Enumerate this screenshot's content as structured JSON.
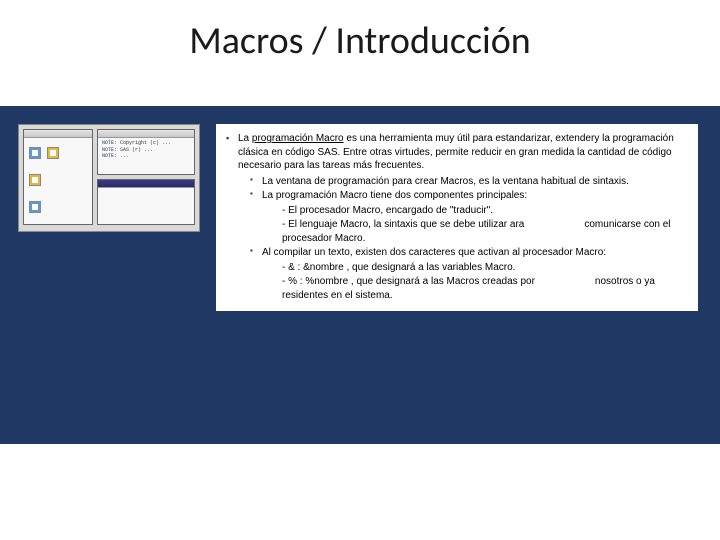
{
  "title": "Macros / Introducción",
  "main": {
    "lead_pre": "La ",
    "lead_term": "programación Macro",
    "lead_post": " es una herramienta muy útil para estandarizar,  extendery la programación clásica en código SAS. Entre otras virtudes, permite reducir en gran medida la cantidad de código necesario para las tareas más frecuentes.",
    "sub1": "La ventana de programación para crear Macros, es la ventana habitual       de sintaxis.",
    "sub2": "La programación Macro tiene dos componentes principales:",
    "sub2a": "- El procesador Macro, encargado de \"traducir\".",
    "sub2b_pre": "- El lenguaje Macro, la sintaxis que se debe utilizar ara",
    "sub2b_post": "comunicarse con el procesador Macro.",
    "sub3": "Al compilar un texto, existen dos caracteres que activan al procesador Macro:",
    "sub3a": "- & : &nombre , que designará a las variables Macro.",
    "sub3b_pre": "- % : %nombre , que designará a las Macros creadas por",
    "sub3b_post": "nosotros o ya residentes en el sistema."
  }
}
